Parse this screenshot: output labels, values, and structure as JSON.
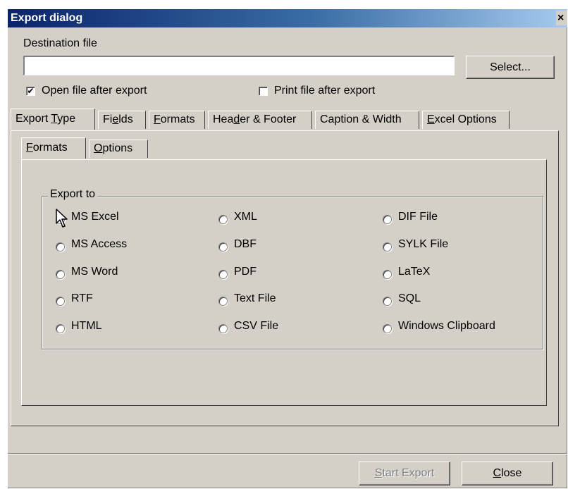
{
  "window": {
    "title": "Export dialog",
    "close_glyph": "×"
  },
  "destination": {
    "label": "Destination file",
    "value": "",
    "select_label": "Select..."
  },
  "options": {
    "open_after": {
      "label": "Open file after export",
      "checked": true
    },
    "print_after": {
      "label": "Print file after export",
      "checked": false
    }
  },
  "tabs": [
    "Export Type",
    "Fields",
    "Formats",
    "Header & Footer",
    "Caption & Width",
    "Excel Options"
  ],
  "subtabs": [
    "Formats",
    "Options"
  ],
  "export_group": {
    "legend": "Export to",
    "options": [
      "MS Excel",
      "MS Access",
      "MS Word",
      "RTF",
      "HTML",
      "XML",
      "DBF",
      "PDF",
      "Text File",
      "CSV File",
      "DIF File",
      "SYLK File",
      "LaTeX",
      "SQL",
      "Windows Clipboard"
    ],
    "selected": "MS Excel"
  },
  "buttons": {
    "start_export": "Start Export",
    "close": "Close"
  },
  "icons": {
    "cursor": "mouse-pointer-icon",
    "check": "checkmark-icon"
  },
  "colors": {
    "face": "#d4d0c8",
    "title_start": "#0a246a",
    "title_end": "#a6caf0"
  }
}
